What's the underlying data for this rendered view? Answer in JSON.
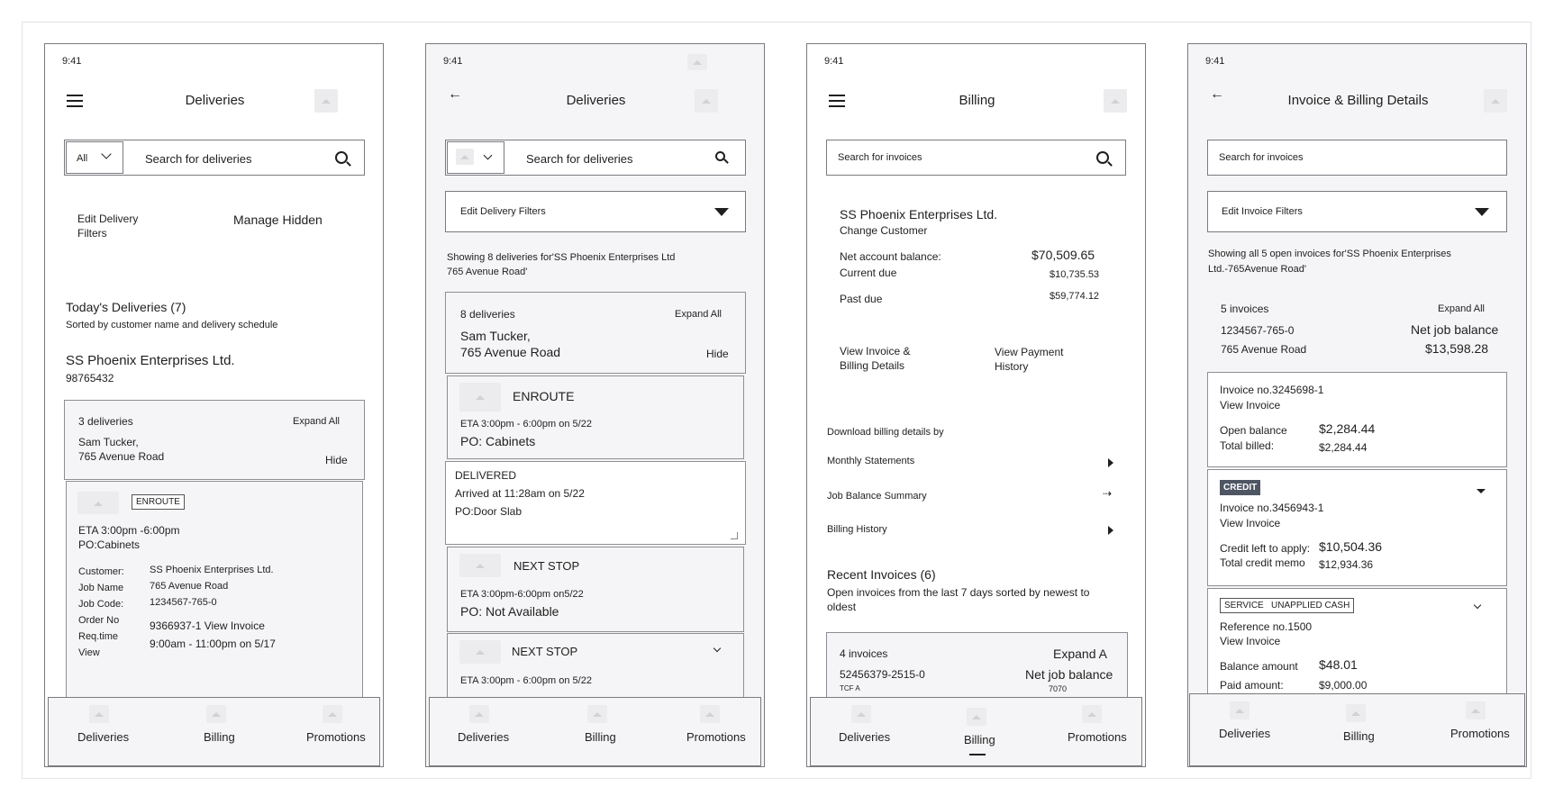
{
  "status_time": "9:41",
  "nav": {
    "deliveries": "Deliveries",
    "billing": "Billing",
    "promotions": "Promotions"
  },
  "screen1": {
    "title": "Deliveries",
    "filter_value": "All",
    "search_placeholder": "Search for deliveries",
    "edit_filters": "Edit Delivery\nFilters",
    "manage_hidden": "Manage Hidden",
    "section_title": "Today's Deliveries (7)",
    "section_sub": "Sorted by customer name and delivery schedule",
    "customer_name": "SS Phoenix Enterprises Ltd.",
    "customer_id": "98765432",
    "group": {
      "count": "3 deliveries",
      "expand": "Expand All",
      "contact": "Sam Tucker,\n765 Avenue Road",
      "hide": "Hide"
    },
    "delivery": {
      "status": "ENROUTE",
      "eta": "ETA 3:00pm -6:00pm",
      "po": "PO:Cabinets",
      "labels": "Customer:\nJob Name\nJob Code:\nOrder No\nReq.time\nView",
      "customer": "SS Phoenix Enterprises Ltd.",
      "job_name": "765 Avenue Road",
      "job_code": "1234567-765-0",
      "order": "9366937-1 View Invoice",
      "req_time": "9:00am - 11:00pm on 5/17"
    }
  },
  "screen2": {
    "title": "Deliveries",
    "search_placeholder": "Search for deliveries",
    "edit_filters": "Edit Delivery Filters",
    "showing": "Showing 8 deliveries for'SS Phoenix Enterprises Ltd\n765 Avenue Road'",
    "group": {
      "count": "8 deliveries",
      "expand": "Expand All",
      "contact": "Sam Tucker,\n765 Avenue Road",
      "hide": "Hide"
    },
    "d1": {
      "status": "ENROUTE",
      "eta": "ETA 3:00pm - 6:00pm on 5/22",
      "po": "PO: Cabinets"
    },
    "d2": {
      "status": "DELIVERED",
      "arrived": "Arrived at 11:28am on 5/22",
      "po": "PO:Door Slab"
    },
    "d3": {
      "status": "NEXT STOP",
      "eta": "ETA 3:00pm-6:00pm on5/22",
      "po": "PO: Not Available"
    },
    "d4": {
      "status": "NEXT STOP",
      "eta": "ETA 3:00pm - 6:00pm on 5/22"
    }
  },
  "screen3": {
    "title": "Billing",
    "search_placeholder": "Search for invoices",
    "customer": "SS Phoenix Enterprises Ltd.",
    "change": "Change Customer",
    "net_label": "Net account balance:",
    "net_value": "$70,509.65",
    "current_label": "Current due",
    "current_value": "$10,735.53",
    "past_label": "Past due",
    "past_value": "$59,774.12",
    "view_invoice": "View Invoice &\nBilling Details",
    "view_payment": "View Payment\nHistory",
    "download_title": "Download billing details by",
    "download_items": [
      "Monthly Statements",
      "Job Balance Summary",
      "Billing History"
    ],
    "recent_title": "Recent Invoices (6)",
    "recent_sub": "Open invoices from the last 7 days sorted by newest to\noldest",
    "card": {
      "count": "4 invoices",
      "expand": "Expand A",
      "job": "52456379-2515-0",
      "net": "Net job balance",
      "row_a": "TCF      A",
      "row_b": "7070"
    }
  },
  "screen4": {
    "title": "Invoice & Billing Details",
    "search_placeholder": "Search for invoices",
    "edit_filters": "Edit Invoice Filters",
    "showing": "Showing all 5 open invoices for'SS Phoenix Enterprises\nLtd.-765Avenue Road'",
    "summary": {
      "count": "5 invoices",
      "expand": "Expand All",
      "job": "1234567-765-0",
      "net_label": "Net job balance",
      "address": "765 Avenue Road",
      "net_value": "$13,598.28"
    },
    "inv1": {
      "number": "Invoice no.3245698-1",
      "view": "View Invoice",
      "l1": "Open balance",
      "v1": "$2,284.44",
      "l2": "Total billed:",
      "v2": "$2,284.44"
    },
    "inv2": {
      "tag": "CREDIT",
      "number": "Invoice no.3456943-1",
      "view": "View Invoice",
      "l1": "Credit left to apply:",
      "v1": "$10,504.36",
      "l2": "Total credit memo",
      "v2": "$12,934.36"
    },
    "inv3": {
      "tag": "SERVICE   UNAPPLIED CASH",
      "number": "Reference no.1500",
      "view": "View Invoice",
      "l1": "Balance amount",
      "v1": "$48.01",
      "l2": "Paid amount:",
      "v2": "$9,000.00"
    }
  }
}
